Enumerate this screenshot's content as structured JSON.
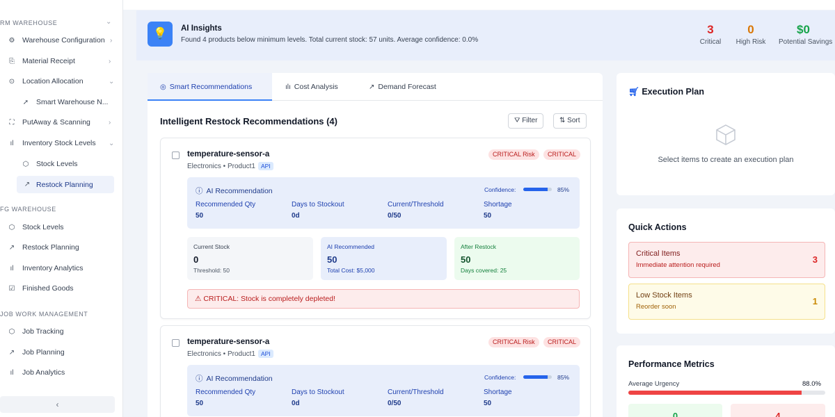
{
  "sidebar": {
    "sections": [
      {
        "label": "RM WAREHOUSE"
      },
      {
        "label": "FG WAREHOUSE"
      },
      {
        "label": "JOB WORK MANAGEMENT"
      }
    ],
    "rm_items": [
      {
        "label": "Warehouse Configuration",
        "icon": "gear-icon",
        "chev": "›"
      },
      {
        "label": "Material Receipt",
        "icon": "receipt-icon",
        "chev": "›"
      },
      {
        "label": "Location Allocation",
        "icon": "pin-icon",
        "chev": "⌄"
      },
      {
        "label": "Smart Warehouse N...",
        "icon": "navigation-icon"
      },
      {
        "label": "PutAway & Scanning",
        "icon": "scan-icon",
        "chev": "›"
      },
      {
        "label": "Inventory Stock Levels",
        "icon": "bar-chart-icon",
        "chev": "⌄"
      },
      {
        "label": "Stock Levels",
        "icon": "box-icon"
      },
      {
        "label": "Restock Planning",
        "icon": "trend-icon"
      }
    ],
    "fg_items": [
      {
        "label": "Stock Levels",
        "icon": "box-icon"
      },
      {
        "label": "Restock Planning",
        "icon": "trend-icon"
      },
      {
        "label": "Inventory Analytics",
        "icon": "bar-chart-icon"
      },
      {
        "label": "Finished Goods",
        "icon": "checkbox-icon"
      }
    ],
    "job_items": [
      {
        "label": "Job Tracking",
        "icon": "box-icon"
      },
      {
        "label": "Job Planning",
        "icon": "trend-icon"
      },
      {
        "label": "Job Analytics",
        "icon": "bar-chart-icon"
      }
    ],
    "collapse_label": "‹"
  },
  "insights": {
    "title": "AI Insights",
    "text": "Found 4 products below minimum levels. Total current stock: 57 units. Average confidence: 0.0%",
    "stats": [
      {
        "value": "3",
        "label": "Critical",
        "color": "#dc2626"
      },
      {
        "value": "0",
        "label": "High Risk",
        "color": "#d97706"
      },
      {
        "value": "$0",
        "label": "Potential Savings",
        "color": "#16a34a"
      }
    ]
  },
  "tabs": [
    {
      "label": "Smart Recommendations",
      "icon": "target-icon",
      "active": true
    },
    {
      "label": "Cost Analysis",
      "icon": "bar-chart-icon"
    },
    {
      "label": "Demand Forecast",
      "icon": "trend-icon"
    }
  ],
  "list": {
    "title": "Intelligent Restock Recommendations (4)",
    "filter_label": "Filter",
    "sort_label": "Sort"
  },
  "cards": [
    {
      "name": "temperature-sensor-a",
      "meta": "Electronics • Product1",
      "tag": "API",
      "risk_badge": "CRITICAL Risk",
      "status_badge": "CRITICAL",
      "ai_title": "AI Recommendation",
      "confidence_label": "Confidence:",
      "confidence": "85%",
      "confidence_fraction": 0.85,
      "metrics": [
        {
          "label": "Recommended Qty",
          "value": "50"
        },
        {
          "label": "Days to Stockout",
          "value": "0d"
        },
        {
          "label": "Current/Threshold",
          "value": "0/50"
        },
        {
          "label": "Shortage",
          "value": "50"
        }
      ],
      "boxes": [
        {
          "label": "Current Stock",
          "value": "0",
          "sub": "Threshold: 50"
        },
        {
          "label": "AI Recommended",
          "value": "50",
          "sub": "Total Cost: $5,000"
        },
        {
          "label": "After Restock",
          "value": "50",
          "sub": "Days covered: 25"
        }
      ],
      "alert": "CRITICAL: Stock is completely depleted!"
    },
    {
      "name": "temperature-sensor-a",
      "meta": "Electronics • Product1",
      "tag": "API",
      "risk_badge": "CRITICAL Risk",
      "status_badge": "CRITICAL",
      "ai_title": "AI Recommendation",
      "confidence_label": "Confidence:",
      "confidence": "85%",
      "confidence_fraction": 0.85,
      "metrics": [
        {
          "label": "Recommended Qty",
          "value": "50"
        },
        {
          "label": "Days to Stockout",
          "value": "0d"
        },
        {
          "label": "Current/Threshold",
          "value": "0/50"
        },
        {
          "label": "Shortage",
          "value": "50"
        }
      ]
    }
  ],
  "execution": {
    "title": "Execution Plan",
    "empty": "Select items to create an execution plan"
  },
  "quick_actions": {
    "title": "Quick Actions",
    "items": [
      {
        "title": "Critical Items",
        "subtitle": "Immediate attention required",
        "count": "3"
      },
      {
        "title": "Low Stock Items",
        "subtitle": "Reorder soon",
        "count": "1"
      }
    ]
  },
  "performance": {
    "title": "Performance Metrics",
    "urgency_label": "Average Urgency",
    "urgency_value": "88.0%",
    "urgency_fraction": 0.88,
    "tile_values": [
      "0",
      "4"
    ]
  },
  "colors": {
    "accent": "#3b82f6",
    "critical": "#dc2626",
    "warning": "#d97706",
    "success": "#16a34a"
  }
}
